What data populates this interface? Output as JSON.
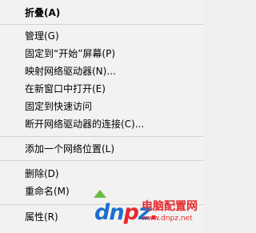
{
  "menu": {
    "items": [
      {
        "label": "折叠(A)",
        "bold": true
      },
      {
        "label": "管理(G)"
      },
      {
        "label": "固定到“开始”屏幕(P)"
      },
      {
        "label": "映射网络驱动器(N)..."
      },
      {
        "label": "在新窗口中打开(E)"
      },
      {
        "label": "固定到快速访问"
      },
      {
        "label": "断开网络驱动器的连接(C)..."
      },
      {
        "label": "添加一个网络位置(L)"
      },
      {
        "label": "删除(D)"
      },
      {
        "label": "重命名(M)"
      },
      {
        "label": "属性(R)"
      }
    ]
  },
  "watermark": {
    "logo_main": "dn",
    "logo_accent": "p",
    "logo_tail": "z",
    "dot": ".",
    "brand_cn": "电脑配置网",
    "url": "www.dnpz.net"
  }
}
